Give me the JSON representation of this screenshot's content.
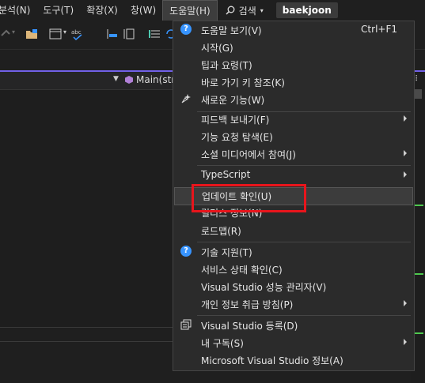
{
  "menubar": {
    "items": [
      {
        "label": "분석(N)"
      },
      {
        "label": "도구(T)"
      },
      {
        "label": "확장(X)"
      },
      {
        "label": "창(W)"
      },
      {
        "label": "도움말(H)"
      }
    ],
    "search_label": "검색",
    "solution_name": "baekjoon"
  },
  "navbar": {
    "member_label": "Main(str"
  },
  "menu": {
    "items": [
      {
        "label": "도움말 보기(V)",
        "shortcut": "Ctrl+F1",
        "icon": "help-icon"
      },
      {
        "label": "시작(G)"
      },
      {
        "label": "팁과 요령(T)"
      },
      {
        "label": "바로 가기 키 참조(K)"
      },
      {
        "label": "새로운 기능(W)",
        "icon": "sparkle-icon"
      },
      {
        "label": "피드백 보내기(F)",
        "submenu": true
      },
      {
        "label": "기능 요청 탐색(E)"
      },
      {
        "label": "소셜 미디어에서 참여(J)",
        "submenu": true
      },
      {
        "label": "TypeScript",
        "submenu": true
      },
      {
        "label": "업데이트 확인(U)",
        "hover": true
      },
      {
        "label": "릴리스 정보(N)"
      },
      {
        "label": "로드맵(R)"
      },
      {
        "label": "기술 지원(T)",
        "icon": "help-icon"
      },
      {
        "label": "서비스 상태 확인(C)"
      },
      {
        "label": "Visual Studio 성능 관리자(V)"
      },
      {
        "label": "개인 정보 취급 방침(P)",
        "submenu": true
      },
      {
        "label": "Visual Studio 등록(D)",
        "icon": "register-icon"
      },
      {
        "label": "내 구독(S)",
        "submenu": true
      },
      {
        "label": "Microsoft Visual Studio 정보(A)"
      }
    ]
  },
  "colors": {
    "accent": "#7160e8",
    "highlight_box": "#e8151c",
    "help_icon": "#3794ff"
  }
}
